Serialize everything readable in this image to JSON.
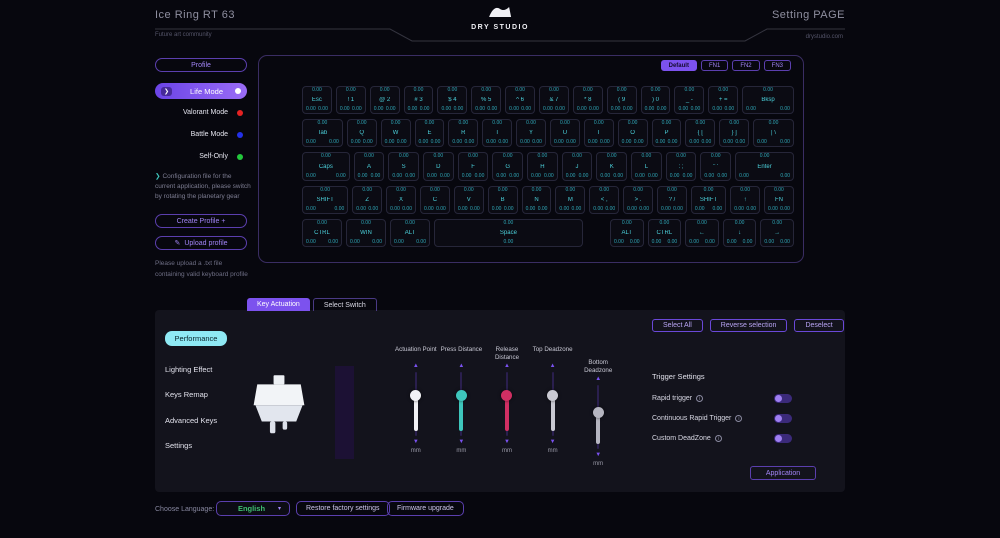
{
  "header": {
    "device_name": "Ice Ring RT 63",
    "device_subtitle": "Future art community",
    "logo_text": "DRY STUDIO",
    "page_title": "Setting PAGE",
    "page_subtitle": "drystudio.com"
  },
  "profile_sidebar": {
    "profile_label": "Profile",
    "modes": [
      {
        "label": "Life Mode",
        "dot": "#ffffff",
        "active": true
      },
      {
        "label": "Valorant Mode",
        "dot": "#e52222",
        "active": false
      },
      {
        "label": "Battle Mode",
        "dot": "#2331e8",
        "active": false
      },
      {
        "label": "Self-Only",
        "dot": "#23c83c",
        "active": false
      }
    ],
    "config_note": "Configuration file for the current application, please switch by rotating the planetary gear",
    "create_profile_label": "Create Profile +",
    "upload_profile_label": "Upload profile",
    "upload_icon": "✎",
    "upload_note": "Please upload a .txt file containing valid keyboard profile"
  },
  "keyboard": {
    "layer_tabs": [
      {
        "label": "Default",
        "active": true
      },
      {
        "label": "FN1",
        "active": false
      },
      {
        "label": "FN2",
        "active": false
      },
      {
        "label": "FN3",
        "active": false
      }
    ],
    "key_top_value": "0.00",
    "key_bottom_value": "0.00",
    "rows": [
      [
        {
          "legend": "Esc",
          "w": 1
        },
        {
          "legend": "! 1",
          "w": 1
        },
        {
          "legend": "@ 2",
          "w": 1
        },
        {
          "legend": "# 3",
          "w": 1
        },
        {
          "legend": "$ 4",
          "w": 1
        },
        {
          "legend": "% 5",
          "w": 1
        },
        {
          "legend": "^ 6",
          "w": 1
        },
        {
          "legend": "& 7",
          "w": 1
        },
        {
          "legend": "* 8",
          "w": 1
        },
        {
          "legend": "( 9",
          "w": 1
        },
        {
          "legend": ") 0",
          "w": 1
        },
        {
          "legend": "_ -",
          "w": 1
        },
        {
          "legend": "+ =",
          "w": 1
        },
        {
          "legend": "Bksp",
          "w": 2
        }
      ],
      [
        {
          "legend": "Tab",
          "w": 1.5
        },
        {
          "legend": "Q",
          "w": 1
        },
        {
          "legend": "W",
          "w": 1
        },
        {
          "legend": "E",
          "w": 1
        },
        {
          "legend": "R",
          "w": 1
        },
        {
          "legend": "T",
          "w": 1
        },
        {
          "legend": "Y",
          "w": 1
        },
        {
          "legend": "U",
          "w": 1
        },
        {
          "legend": "I",
          "w": 1
        },
        {
          "legend": "O",
          "w": 1
        },
        {
          "legend": "P",
          "w": 1
        },
        {
          "legend": "{ [",
          "w": 1
        },
        {
          "legend": "} ]",
          "w": 1
        },
        {
          "legend": "| \\",
          "w": 1.5
        }
      ],
      [
        {
          "legend": "Caps",
          "w": 1.75
        },
        {
          "legend": "A",
          "w": 1
        },
        {
          "legend": "S",
          "w": 1
        },
        {
          "legend": "D",
          "w": 1
        },
        {
          "legend": "F",
          "w": 1
        },
        {
          "legend": "G",
          "w": 1
        },
        {
          "legend": "H",
          "w": 1
        },
        {
          "legend": "J",
          "w": 1
        },
        {
          "legend": "K",
          "w": 1
        },
        {
          "legend": "L",
          "w": 1
        },
        {
          "legend": ": ;",
          "w": 1
        },
        {
          "legend": "\" '",
          "w": 1
        },
        {
          "legend": "Enter",
          "w": 2.25
        }
      ],
      [
        {
          "legend": "SHIFT",
          "w": 1.75
        },
        {
          "legend": "Z",
          "w": 1
        },
        {
          "legend": "X",
          "w": 1
        },
        {
          "legend": "C",
          "w": 1
        },
        {
          "legend": "V",
          "w": 1
        },
        {
          "legend": "B",
          "w": 1
        },
        {
          "legend": "N",
          "w": 1
        },
        {
          "legend": "M",
          "w": 1
        },
        {
          "legend": "< ,",
          "w": 1
        },
        {
          "legend": "> .",
          "w": 1
        },
        {
          "legend": "? /",
          "w": 1
        },
        {
          "legend": "SHIFT",
          "w": 1.25
        },
        {
          "legend": "↑",
          "w": 1
        },
        {
          "legend": "FN",
          "w": 1
        }
      ],
      [
        {
          "legend": "CTRL",
          "w": 1.25
        },
        {
          "legend": "WIN",
          "w": 1.25
        },
        {
          "legend": "ALT",
          "w": 1.25
        },
        {
          "legend": "Space",
          "w": 5.5,
          "single": true
        },
        {
          "spacer": true,
          "w": 0.75
        },
        {
          "legend": "ALT",
          "w": 1
        },
        {
          "legend": "CTRL",
          "w": 1
        },
        {
          "legend": "←",
          "w": 1
        },
        {
          "legend": "↓",
          "w": 1
        },
        {
          "legend": "→",
          "w": 1
        }
      ]
    ]
  },
  "actuation_panel": {
    "tabs": [
      {
        "label": "Key Actuation",
        "active": true
      },
      {
        "label": "Select Switch",
        "active": false
      }
    ],
    "nav": [
      {
        "label": "Performance",
        "active": true
      },
      {
        "label": "Lighting Effect",
        "active": false
      },
      {
        "label": "Keys Remap",
        "active": false
      },
      {
        "label": "Advanced Keys",
        "active": false
      },
      {
        "label": "Settings",
        "active": false
      }
    ],
    "selection_buttons": [
      "Select All",
      "Reverse selection",
      "Deselect"
    ],
    "sliders": [
      {
        "label": "Actuation Point",
        "color": "#f2f2f6",
        "knob": 36,
        "unit": "mm",
        "offset": false
      },
      {
        "label": "Press Distance",
        "color": "#3ec6bc",
        "knob": 36,
        "unit": "mm",
        "offset": false
      },
      {
        "label": "Release Distance",
        "color": "#d12f63",
        "knob": 36,
        "unit": "mm",
        "offset": false
      },
      {
        "label": "Top Deadzone",
        "color": "#c9c9d2",
        "knob": 36,
        "unit": "mm",
        "offset": false
      },
      {
        "label": "Bottom Deadzone",
        "color": "#b5b5c0",
        "knob": 42,
        "unit": "mm",
        "offset": true
      }
    ],
    "trigger": {
      "title": "Trigger Settings",
      "items": [
        {
          "label": "Rapid trigger",
          "info": "i",
          "on": true
        },
        {
          "label": "Continuous Rapid Trigger",
          "info": "i",
          "on": true
        },
        {
          "label": "Custom DeadZone",
          "info": "i",
          "on": true
        }
      ]
    },
    "apply_label": "Application"
  },
  "footer": {
    "language_label": "Choose Language:",
    "language_value": "English",
    "restore_label": "Restore factory settings",
    "firmware_label": "Firmware upgrade"
  },
  "colors": {
    "accent": "#7c52ee",
    "key_text": "#4bd0da",
    "performance_tab": "#8fe9f4",
    "language_value": "#3fbf70"
  }
}
